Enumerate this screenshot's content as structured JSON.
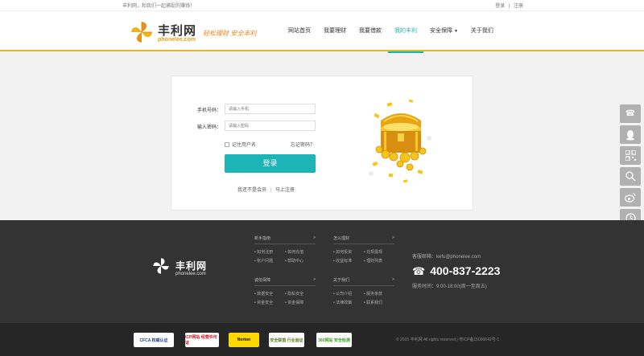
{
  "topbar": {
    "welcome": "丰利网，和我们一起捕捉的赚钱！",
    "login": "登录",
    "separator": "|",
    "register": "注册"
  },
  "header": {
    "brand": "丰利网",
    "brand_url": "phonelee.com",
    "slogan": "轻松理财  安全丰利",
    "accent_color": "#f2b318",
    "nav": [
      "网站首页",
      "我要理财",
      "我要借款",
      "我的丰利",
      "安全保障",
      "关于我们"
    ],
    "active_nav": "我的丰利"
  },
  "login": {
    "phone_label": "手机号码：",
    "phone_placeholder": "请输入手机",
    "password_label": "输入密码：",
    "password_placeholder": "请输入密码",
    "remember": "记住用户名",
    "forgot": "忘记密码？",
    "button": "登录",
    "not_member": "我还不是会员",
    "separator": "|",
    "register_now": "马上注册",
    "button_color": "#1db4b5"
  },
  "sidebar": {
    "icons": [
      "phone-icon",
      "qq-icon",
      "qrcode-icon",
      "search-question-icon",
      "weibo-icon",
      "clock-icon",
      "back-to-top-icon"
    ]
  },
  "footer": {
    "brand": "丰利网",
    "brand_url": "phonelee.com",
    "columns": [
      {
        "title": "新手指南",
        "arrow": ">",
        "items": [
          "如何注册",
          "如何充值",
          "账户问题",
          "帮助中心"
        ]
      },
      {
        "title": "怎么理财",
        "arrow": ">",
        "items": [
          "如何投资",
          "兑现提现",
          "收益标准",
          "理财列表"
        ]
      },
      {
        "title": "诚信保障",
        "arrow": ">",
        "items": [
          "数据安全",
          "隐私安全",
          "资金安全",
          "资金保障"
        ]
      },
      {
        "title": "关于我们",
        "arrow": ">",
        "items": [
          "公司介绍",
          "服务条款",
          "法律政策",
          "联系我们"
        ]
      }
    ],
    "email": "客服邮箱：kefu@phonelee.com",
    "phone": "400-837-2223",
    "hours": "服务时间：9:00-18:00(周一至周五)",
    "badges": [
      {
        "name": "cfca-badge",
        "label": "CFCA 权威认证",
        "color": "#1f3e8c",
        "bg": "#ffffff"
      },
      {
        "name": "icp-badge",
        "label": "ICP网站 经营许可证",
        "color": "#c8161d",
        "bg": "#ffffff"
      },
      {
        "name": "norton-badge",
        "label": "Norton",
        "color": "#000000",
        "bg": "#ffd700"
      },
      {
        "name": "safety-badge",
        "label": "安全联盟 行业验证",
        "color": "#5a7a1a",
        "bg": "#ffffff"
      },
      {
        "name": "360-badge",
        "label": "360网站 安全检测",
        "color": "#3a9b27",
        "bg": "#ffffff"
      }
    ],
    "copyright": "© 2015 丰利网 All rights reserved | 粤ICP备15000642号-1"
  }
}
